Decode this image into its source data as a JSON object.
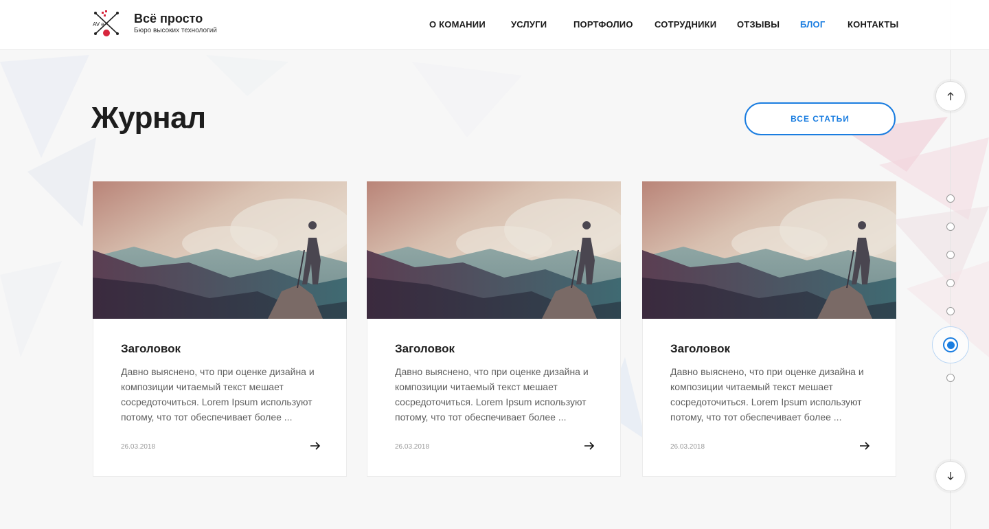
{
  "brand": {
    "name": "Всё просто",
    "tagline": "Бюро высоких технологий",
    "logo_text": "AV e"
  },
  "nav": {
    "items": [
      {
        "label": "О КОМАНИИ",
        "active": false
      },
      {
        "label": "УСЛУГИ",
        "active": false
      },
      {
        "label": "ПОРТФОЛИО",
        "active": false
      },
      {
        "label": "СОТРУДНИКИ",
        "active": false
      },
      {
        "label": "ОТЗЫВЫ",
        "active": false
      },
      {
        "label": "БЛОГ",
        "active": true
      },
      {
        "label": "КОНТАКТЫ",
        "active": false
      }
    ]
  },
  "section": {
    "title": "Журнал",
    "all_button": "ВСЕ СТАТЬИ"
  },
  "cards": [
    {
      "title": "Заголовок",
      "text": "Давно выяснено, что при оценке дизайна и композиции читаемый текст мешает сосредоточиться. Lorem Ipsum используют потому, что тот обеспечивает более ...",
      "date": "26.03.2018"
    },
    {
      "title": "Заголовок",
      "text": "Давно выяснено, что при оценке дизайна и композиции читаемый текст мешает сосредоточиться. Lorem Ipsum используют потому, что тот обеспечивает более ...",
      "date": "26.03.2018"
    },
    {
      "title": "Заголовок",
      "text": "Давно выяснено, что при оценке дизайна и композиции читаемый текст мешает сосредоточиться. Lorem Ipsum используют потому, что тот обеспечивает более ...",
      "date": "26.03.2018"
    }
  ],
  "rail": {
    "active_index": 5,
    "dot_count": 7,
    "up_icon": "arrow-up-icon",
    "down_icon": "arrow-down-icon"
  },
  "colors": {
    "accent": "#1a7de0",
    "text": "#1e1e1e",
    "muted": "#5e5e5e",
    "background": "#f7f7f7"
  }
}
